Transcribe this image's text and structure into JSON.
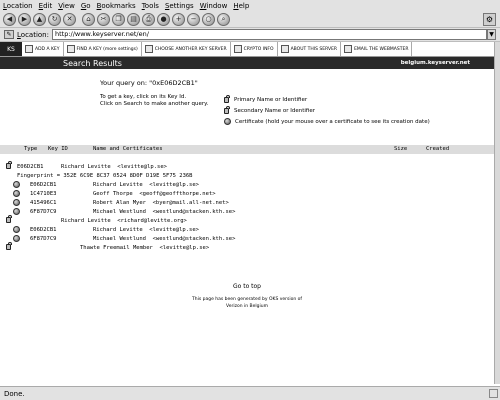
{
  "menu": [
    "Location",
    "Edit",
    "View",
    "Go",
    "Bookmarks",
    "Tools",
    "Settings",
    "Window",
    "Help"
  ],
  "toolbar": {
    "buttons": [
      "back-icon",
      "forward-icon",
      "up-icon",
      "reload-icon",
      "stop-icon",
      "home-icon",
      "cut-icon",
      "copy-icon",
      "paste-icon",
      "print-icon",
      "lock-icon",
      "zoom-in-icon",
      "zoom-out-icon",
      "zoom-fit-icon",
      "find-icon"
    ]
  },
  "location": {
    "label": "Location:",
    "url": "http://www.keyserver.net/en/"
  },
  "site_nav": {
    "items": [
      {
        "label": "ADD A KEY",
        "icon": "key-icon"
      },
      {
        "label": "FIND A KEY (more settings)",
        "icon": "search-icon"
      },
      {
        "label": "CHOOSE ANOTHER KEY SERVER",
        "icon": "globe-icon"
      },
      {
        "label": "CRYPTO INFO",
        "icon": "info-icon"
      },
      {
        "label": "ABOUT THIS SERVER",
        "icon": "server-icon"
      },
      {
        "label": "EMAIL THE WEBMASTER",
        "icon": "mail-icon"
      }
    ]
  },
  "results_bar": {
    "title": "Search Results",
    "server": "belgium.keyserver.net"
  },
  "query_text": "Your query on: \"0xE06D2CB1\"",
  "help": {
    "line1": "To get a key, click on its Key Id.",
    "line2": "Click on Search to make another query."
  },
  "legend": [
    {
      "icon": "lock",
      "label": "Primary Name or Identifier"
    },
    {
      "icon": "lock",
      "label": "Secondary Name or Identifier"
    },
    {
      "icon": "cert",
      "label": "Certificate (hold your mouse over a certificate to see its creation date)"
    }
  ],
  "columns": [
    "Type",
    "Key ID",
    "Name and Certificates",
    "Size",
    "Created"
  ],
  "rows": [
    {
      "icon": "lock",
      "key_id": "E06D2CB1",
      "uid": "Richard Levitte  <levitte@lp.se>",
      "indent": 0
    },
    {
      "icon": "",
      "key_id": "",
      "uid": "Fingerprint = 352E 6C9E 8C37 0524 8D0F D19E 5F75 236B",
      "indent": 0
    },
    {
      "icon": "cert",
      "key_id": "E06D2CB1",
      "uid": "Richard Levitte  <levitte@lp.se>",
      "indent": 1
    },
    {
      "icon": "cert",
      "key_id": "1C4710E3",
      "uid": "Geoff Thorpe  <geoff@geoffthorpe.net>",
      "indent": 1
    },
    {
      "icon": "cert",
      "key_id": "415496C1",
      "uid": "Robert Alan Myer  <byer@mail.all-net.net>",
      "indent": 1
    },
    {
      "icon": "cert",
      "key_id": "6F87D7C9",
      "uid": "Michael Westlund  <westlund@stacken.kth.se>",
      "indent": 1
    },
    {
      "icon": "lock",
      "key_id": "",
      "uid": "Richard Levitte  <richard@levitte.org>",
      "indent": 0
    },
    {
      "icon": "cert",
      "key_id": "E06D2CB1",
      "uid": "Richard Levitte  <levitte@lp.se>",
      "indent": 1
    },
    {
      "icon": "cert",
      "key_id": "6F87D7C9",
      "uid": "Michael Westlund  <westlund@stacken.kth.se>",
      "indent": 1
    },
    {
      "icon": "lock",
      "key_id": "",
      "uid": "Thawte Freemail Member  <levitte@lp.se>",
      "indent": 0
    }
  ],
  "footer": {
    "go_to_top": "Go to top",
    "line1": "This page has been generated by OKS version of",
    "line2": "Verizon in Belgium"
  },
  "status": "Done."
}
